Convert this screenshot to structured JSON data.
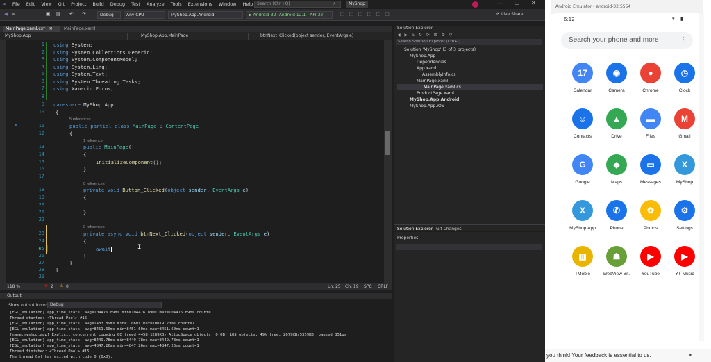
{
  "vs": {
    "menu": [
      "File",
      "Edit",
      "View",
      "Git",
      "Project",
      "Build",
      "Debug",
      "Test",
      "Analyze",
      "Tools",
      "Extensions",
      "Window",
      "Help"
    ],
    "search": "Search (Ctrl+Q)",
    "app_name": "MyShop",
    "toolbar": {
      "config": "Debug",
      "platform": "Any CPU",
      "project": "MyShop.App.Android",
      "run": "▶ Android-32 (Android 12.1 - API 32)",
      "live_share": "Live Share"
    },
    "tabs": [
      {
        "label": "MainPage.xaml.cs*"
      },
      {
        "label": "MainPage.xaml"
      }
    ],
    "nav": {
      "project": "MyShop.App",
      "class": "MyShop.App.MainPage",
      "member": "btnNext_Clicked(object sender, EventArgs e)"
    },
    "code": {
      "line_numbers": [
        "1",
        "2",
        "3",
        "4",
        "5",
        "6",
        "7",
        "8",
        "9",
        "10",
        "11",
        "12",
        "13",
        "14",
        "15",
        "16",
        "17",
        "18",
        "19",
        "20",
        "21",
        "22",
        "23",
        "24",
        "25",
        "26",
        "27",
        "28",
        "29"
      ],
      "usings": [
        "System",
        "System.Collections.Generic",
        "System.ComponentModel",
        "System.Linq",
        "System.Text",
        "System.Threading.Tasks",
        "Xamarin.Forms"
      ],
      "namespace_name": "MyShop.App",
      "refs": {
        "r5": "5 references",
        "r1": "1 reference",
        "r0a": "0 references",
        "r0b": "0 references"
      },
      "class_name": "MainPage",
      "base_class": "ContentPage",
      "ctor_name": "MainPage",
      "init_call": "InitializeComponent",
      "m1_name": "Button_Clicked",
      "m2_name": "btnNext_Clicked",
      "p_obj": "object",
      "p_sender": "sender",
      "p_args": "EventArgs",
      "p_e": "e",
      "await_kw": "await"
    },
    "status": {
      "zoom": "118 %",
      "errors": "2",
      "warnings": "0",
      "ln": "Ln: 25",
      "ch": "Ch: 19",
      "spc": "SPC",
      "crlf": "CRLF"
    },
    "output": {
      "title": "Output",
      "source_label": "Show output from:",
      "source": "Debug",
      "lines": [
        "[EGL_emulation] app_time_stats: avg=104476.89ms min=104476.89ms max=104476.89ms count=1",
        "Thread started: <Thread Pool> #16",
        "[EGL_emulation] app_time_stats: avg=1433.89ms min=1.06ms max=10019.20ms count=7",
        "[EGL_emulation] app_time_stats: avg=8451.60ms min=8451.60ms max=8451.60ms count=1",
        "[name.myshop.app] Explicit concurrent copying GC freed 4458(1289KB) AllocSpace objects, 0(0B) LOS objects, 49% free, 2679KB/5359KB, paused 351us",
        "[EGL_emulation] app_time_stats: avg=8449.78ms min=8449.78ms max=8449.78ms count=1",
        "[EGL_emulation] app_time_stats: avg=4847.26ms min=4847.26ms max=4847.26ms count=1",
        "Thread finished: <Thread Pool> #15",
        "The thread 0xf has exited with code 0 (0x0)."
      ]
    },
    "solution": {
      "title": "Solution Explorer",
      "search": "Search Solution Explorer (Ctrl+;)",
      "items": [
        "Solution 'MyShop' (3 of 3 projects)",
        "MyShop.App",
        "Dependencies",
        "App.xaml",
        "AssemblyInfo.cs",
        "MainPage.xaml",
        "MainPage.xaml.cs",
        "ProductPage.xaml",
        "MyShop.App.Android",
        "MyShop.App.iOS"
      ],
      "tabs": [
        "Solution Explorer",
        "Git Changes"
      ],
      "properties": "Properties"
    }
  },
  "emulator": {
    "title": "Android Emulator - android-32:5554",
    "time": "6:12",
    "search": "Search your phone and more",
    "apps": [
      {
        "label": "Calendar",
        "glyph": "17",
        "color": "#4285f4"
      },
      {
        "label": "Camera",
        "glyph": "◉",
        "color": "#1a73e8"
      },
      {
        "label": "Chrome",
        "glyph": "●",
        "color": "#ea4335"
      },
      {
        "label": "Clock",
        "glyph": "◷",
        "color": "#1a73e8"
      },
      {
        "label": "Contacts",
        "glyph": "☺",
        "color": "#1a73e8"
      },
      {
        "label": "Drive",
        "glyph": "▲",
        "color": "#34a853"
      },
      {
        "label": "Files",
        "glyph": "▬",
        "color": "#4285f4"
      },
      {
        "label": "Gmail",
        "glyph": "M",
        "color": "#ea4335"
      },
      {
        "label": "Google",
        "glyph": "G",
        "color": "#4285f4"
      },
      {
        "label": "Maps",
        "glyph": "◆",
        "color": "#34a853"
      },
      {
        "label": "Messages",
        "glyph": "▭",
        "color": "#1a73e8"
      },
      {
        "label": "MyShop",
        "glyph": "X",
        "color": "#3498db"
      },
      {
        "label": "MyShop.App",
        "glyph": "X",
        "color": "#3498db"
      },
      {
        "label": "Phone",
        "glyph": "✆",
        "color": "#1a73e8"
      },
      {
        "label": "Photos",
        "glyph": "✿",
        "color": "#fbbc05"
      },
      {
        "label": "Settings",
        "glyph": "⚙",
        "color": "#1a73e8"
      },
      {
        "label": "TMoble",
        "glyph": "▥",
        "color": "#e8b400"
      },
      {
        "label": "WebView Br..",
        "glyph": "☗",
        "color": "#689f38"
      },
      {
        "label": "YouTube",
        "glyph": "▶",
        "color": "#ff0000"
      },
      {
        "label": "YT Music",
        "glyph": "▶",
        "color": "#ff0000"
      }
    ]
  },
  "feedback": "you think! Your feedback is essential to us."
}
